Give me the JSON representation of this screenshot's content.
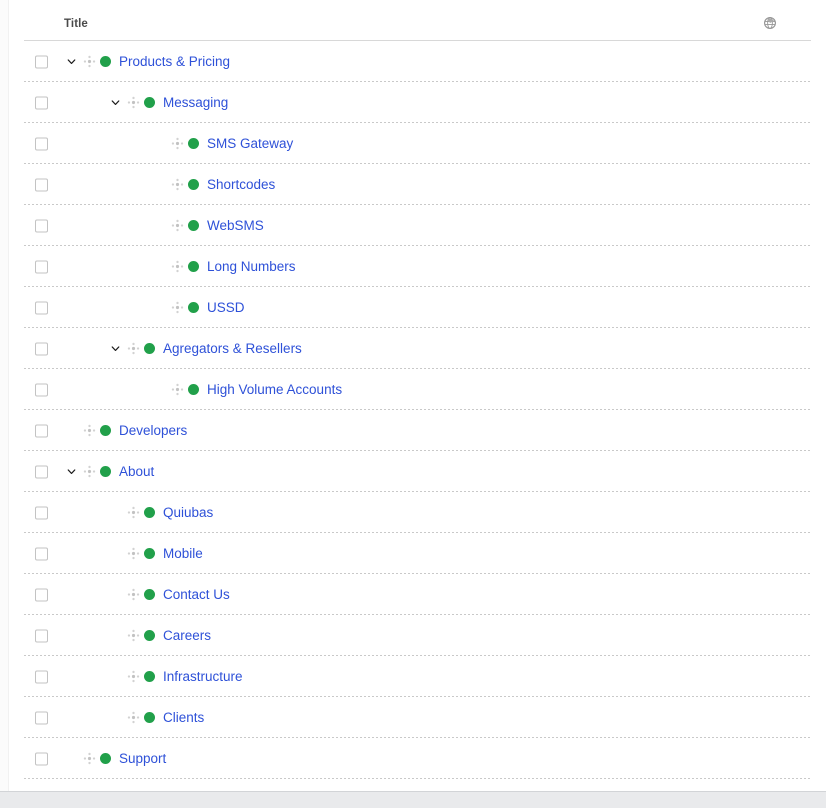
{
  "colors": {
    "link": "#2e51d8",
    "status_green": "#21a04a",
    "header_text": "#4a4a4a",
    "row_separator": "#c9c9c9",
    "footer": "#e9eaec"
  },
  "header": {
    "title_column_label": "Title",
    "right_icon": "globe-icon"
  },
  "rows": [
    {
      "title": "Products & Pricing",
      "level": 1,
      "expandable": true,
      "expanded": true,
      "status": "green",
      "checked": false
    },
    {
      "title": "Messaging",
      "level": 2,
      "expandable": true,
      "expanded": true,
      "status": "green",
      "checked": false
    },
    {
      "title": "SMS Gateway",
      "level": 3,
      "expandable": false,
      "expanded": false,
      "status": "green",
      "checked": false
    },
    {
      "title": "Shortcodes",
      "level": 3,
      "expandable": false,
      "expanded": false,
      "status": "green",
      "checked": false
    },
    {
      "title": "WebSMS",
      "level": 3,
      "expandable": false,
      "expanded": false,
      "status": "green",
      "checked": false
    },
    {
      "title": "Long Numbers",
      "level": 3,
      "expandable": false,
      "expanded": false,
      "status": "green",
      "checked": false
    },
    {
      "title": "USSD",
      "level": 3,
      "expandable": false,
      "expanded": false,
      "status": "green",
      "checked": false
    },
    {
      "title": "Agregators & Resellers",
      "level": 2,
      "expandable": true,
      "expanded": true,
      "status": "green",
      "checked": false
    },
    {
      "title": "High Volume Accounts",
      "level": 3,
      "expandable": false,
      "expanded": false,
      "status": "green",
      "checked": false
    },
    {
      "title": "Developers",
      "level": 1,
      "expandable": false,
      "expanded": false,
      "status": "green",
      "checked": false
    },
    {
      "title": "About",
      "level": 1,
      "expandable": true,
      "expanded": true,
      "status": "green",
      "checked": false
    },
    {
      "title": "Quiubas",
      "level": 2,
      "expandable": false,
      "expanded": false,
      "status": "green",
      "checked": false
    },
    {
      "title": "Mobile",
      "level": 2,
      "expandable": false,
      "expanded": false,
      "status": "green",
      "checked": false
    },
    {
      "title": "Contact Us",
      "level": 2,
      "expandable": false,
      "expanded": false,
      "status": "green",
      "checked": false
    },
    {
      "title": "Careers",
      "level": 2,
      "expandable": false,
      "expanded": false,
      "status": "green",
      "checked": false
    },
    {
      "title": "Infrastructure",
      "level": 2,
      "expandable": false,
      "expanded": false,
      "status": "green",
      "checked": false
    },
    {
      "title": "Clients",
      "level": 2,
      "expandable": false,
      "expanded": false,
      "status": "green",
      "checked": false
    },
    {
      "title": "Support",
      "level": 1,
      "expandable": false,
      "expanded": false,
      "status": "green",
      "checked": false
    }
  ]
}
